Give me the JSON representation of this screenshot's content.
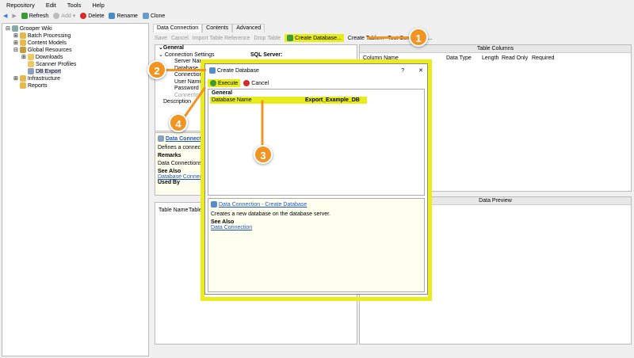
{
  "menu": [
    "Repository",
    "Edit",
    "Tools",
    "Help"
  ],
  "toolbar": {
    "refresh": "Refresh",
    "add": "Add",
    "delete": "Delete",
    "rename": "Rename",
    "clone": "Clone"
  },
  "tree": [
    "Grooper Wiki",
    "Batch Processing",
    "Content Models",
    "Global Resources",
    "Downloads",
    "Scanner Profiles",
    "DB Export",
    "Infrastructure",
    "Reports"
  ],
  "tabs": [
    "Data Connection",
    "Contents",
    "Advanced"
  ],
  "right_toolbar": {
    "save": "Save",
    "cancel": "Cancel",
    "import": "Import Table Reference",
    "drop": "Drop Table",
    "create_db": "Create Database...",
    "create_table": "Create Table...",
    "test": "Test Connection..."
  },
  "props": {
    "general": "General",
    "conn_settings": "Connection Settings",
    "conn_value": "SQL Server:",
    "rows": [
      "Server Name",
      "Database",
      "Connection Timeout",
      "User Name",
      "Password",
      "Connection String"
    ],
    "description": "Description"
  },
  "help": {
    "title": "Data Connection",
    "text": "Defines a connection",
    "remarks": "Remarks",
    "remarks_text": "Data Connections sto",
    "see_also": "See Also",
    "link": "Database Connection",
    "used_by": "Used By"
  },
  "table_columns": {
    "title": "Table Columns",
    "cols": [
      "Column Name",
      "Data Type",
      "Length",
      "Read Only",
      "Required"
    ]
  },
  "table_list": {
    "cols": [
      "Table Name",
      "Table Sc"
    ]
  },
  "data_preview": {
    "title": "Data Preview"
  },
  "dialog": {
    "title": "Create Database",
    "help_btn": "?",
    "close": "✕",
    "execute": "Execute",
    "cancel": "Cancel",
    "general": "General",
    "prop_name": "Database Name",
    "prop_value": "Export_Example_DB",
    "help_title": "Data Connection - Create Database",
    "help_text": "Creates a new database on the database server.",
    "see_also": "See Also",
    "link": "Data Connection"
  },
  "callouts": [
    "1",
    "2",
    "3",
    "4"
  ]
}
